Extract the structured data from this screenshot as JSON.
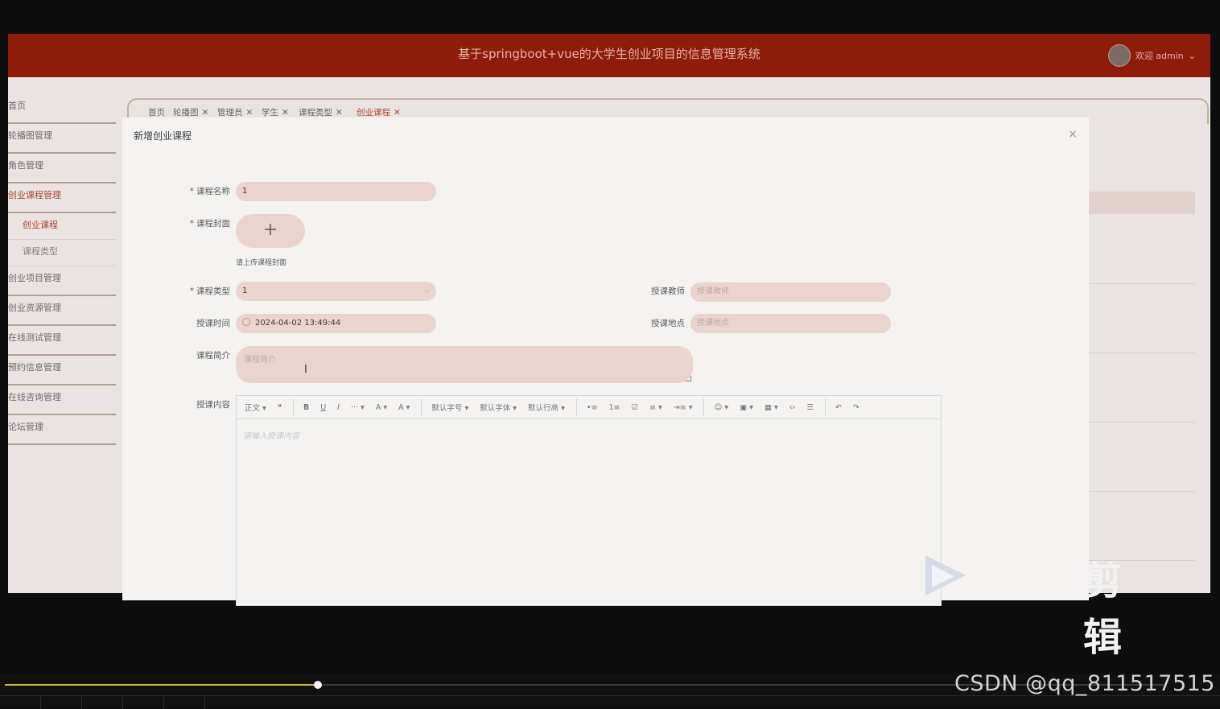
{
  "app": {
    "title": "基于springboot+vue的大学生创业项目的信息管理系统",
    "user_label": "欢迎 admin"
  },
  "sidebar": {
    "items": [
      {
        "label": "首页"
      },
      {
        "label": "轮播图管理"
      },
      {
        "label": "角色管理"
      },
      {
        "label": "创业课程管理",
        "active": true
      },
      {
        "label": "创业课程",
        "sub": true,
        "active": true
      },
      {
        "label": "课程类型",
        "sub": true
      },
      {
        "label": "创业项目管理"
      },
      {
        "label": "创业资源管理"
      },
      {
        "label": "在线测试管理"
      },
      {
        "label": "预约信息管理"
      },
      {
        "label": "在线咨询管理"
      },
      {
        "label": "论坛管理"
      }
    ]
  },
  "tabs": [
    {
      "label": "首页"
    },
    {
      "label": "轮播图"
    },
    {
      "label": "管理员"
    },
    {
      "label": "学生"
    },
    {
      "label": "课程类型"
    },
    {
      "label": "创业课程",
      "active": true
    }
  ],
  "modal": {
    "title": "新增创业课程",
    "close": "×",
    "fields": {
      "name_label": "课程名称",
      "name_value": "1",
      "cover_label": "课程封面",
      "cover_tip": "请上传课程封面",
      "type_label": "课程类型",
      "type_value": "1",
      "teacher_label": "授课教师",
      "teacher_placeholder": "授课教师",
      "time_label": "授课时间",
      "time_value": "2024-04-02 13:49:44",
      "place_label": "授课地点",
      "place_placeholder": "授课地点",
      "intro_label": "课程简介",
      "intro_placeholder": "课程简介",
      "content_label": "授课内容",
      "content_placeholder": "请输入授课内容"
    },
    "toolbar": [
      "正文",
      "❝",
      "B",
      "U",
      "I",
      "···",
      "A",
      "A",
      "默认字号",
      "默认字体",
      "默认行高",
      "•≡",
      "1≡",
      "☑",
      "≡",
      "⇥≡",
      "☺",
      "▣",
      "▦",
      "‹›",
      "☰",
      "↶",
      "↷"
    ]
  },
  "player": {
    "progress": 0.27
  },
  "watermark": "CSDN @qq_811517515",
  "edit_logo_text": "剪辑"
}
